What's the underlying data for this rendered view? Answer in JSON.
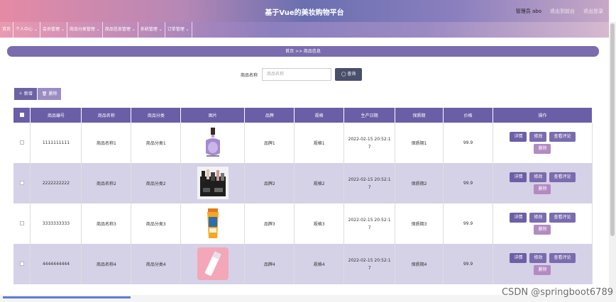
{
  "header": {
    "title": "基于Vue的美妆购物平台",
    "user": "管理员 abo",
    "back_label": "退出到前台",
    "logout_label": "退出登录"
  },
  "menu": [
    {
      "label": "首页"
    },
    {
      "label": "个人中心 ⌄"
    },
    {
      "label": "会员管理 ⌄"
    },
    {
      "label": "商品分类管理 ⌄"
    },
    {
      "label": "商品信息管理 ⌄"
    },
    {
      "label": "系统管理 ⌄"
    },
    {
      "label": "订单管理 ⌄"
    }
  ],
  "breadcrumb": "首页 >> 商品信息",
  "search": {
    "label": "商品名称",
    "placeholder": "商品名称",
    "button": "◯ 查询"
  },
  "actions": {
    "add": "＋ 新增",
    "delete": "🗑 删除"
  },
  "table": {
    "headers": [
      "商品编号",
      "商品名称",
      "商品分类",
      "图片",
      "品牌",
      "规格",
      "生产日期",
      "保质期",
      "价格",
      "操作"
    ],
    "rows": [
      {
        "id": "1111111111",
        "name": "商品名称1",
        "category": "商品分类1",
        "brand": "品牌1",
        "spec": "规格1",
        "date": "2022-02-15 20:52:1\n7",
        "shelf": "保质期1",
        "price": "99.9"
      },
      {
        "id": "2222222222",
        "name": "商品名称2",
        "category": "商品分类2",
        "brand": "品牌2",
        "spec": "规格2",
        "date": "2022-02-15 20:52:1\n7",
        "shelf": "保质期2",
        "price": "99.9"
      },
      {
        "id": "3333333333",
        "name": "商品名称3",
        "category": "商品分类3",
        "brand": "品牌3",
        "spec": "规格3",
        "date": "2022-02-15 20:52:1\n7",
        "shelf": "保质期3",
        "price": "99.9"
      },
      {
        "id": "4444444444",
        "name": "商品名称4",
        "category": "商品分类4",
        "brand": "品牌4",
        "spec": "规格4",
        "date": "2022-02-15 20:52:1\n7",
        "shelf": "保质期4",
        "price": "99.9"
      }
    ],
    "ops": {
      "detail": "详情",
      "edit": "修改",
      "comments": "查看评论",
      "delete": "删除"
    }
  },
  "watermark": "CSDN @springboot6789"
}
